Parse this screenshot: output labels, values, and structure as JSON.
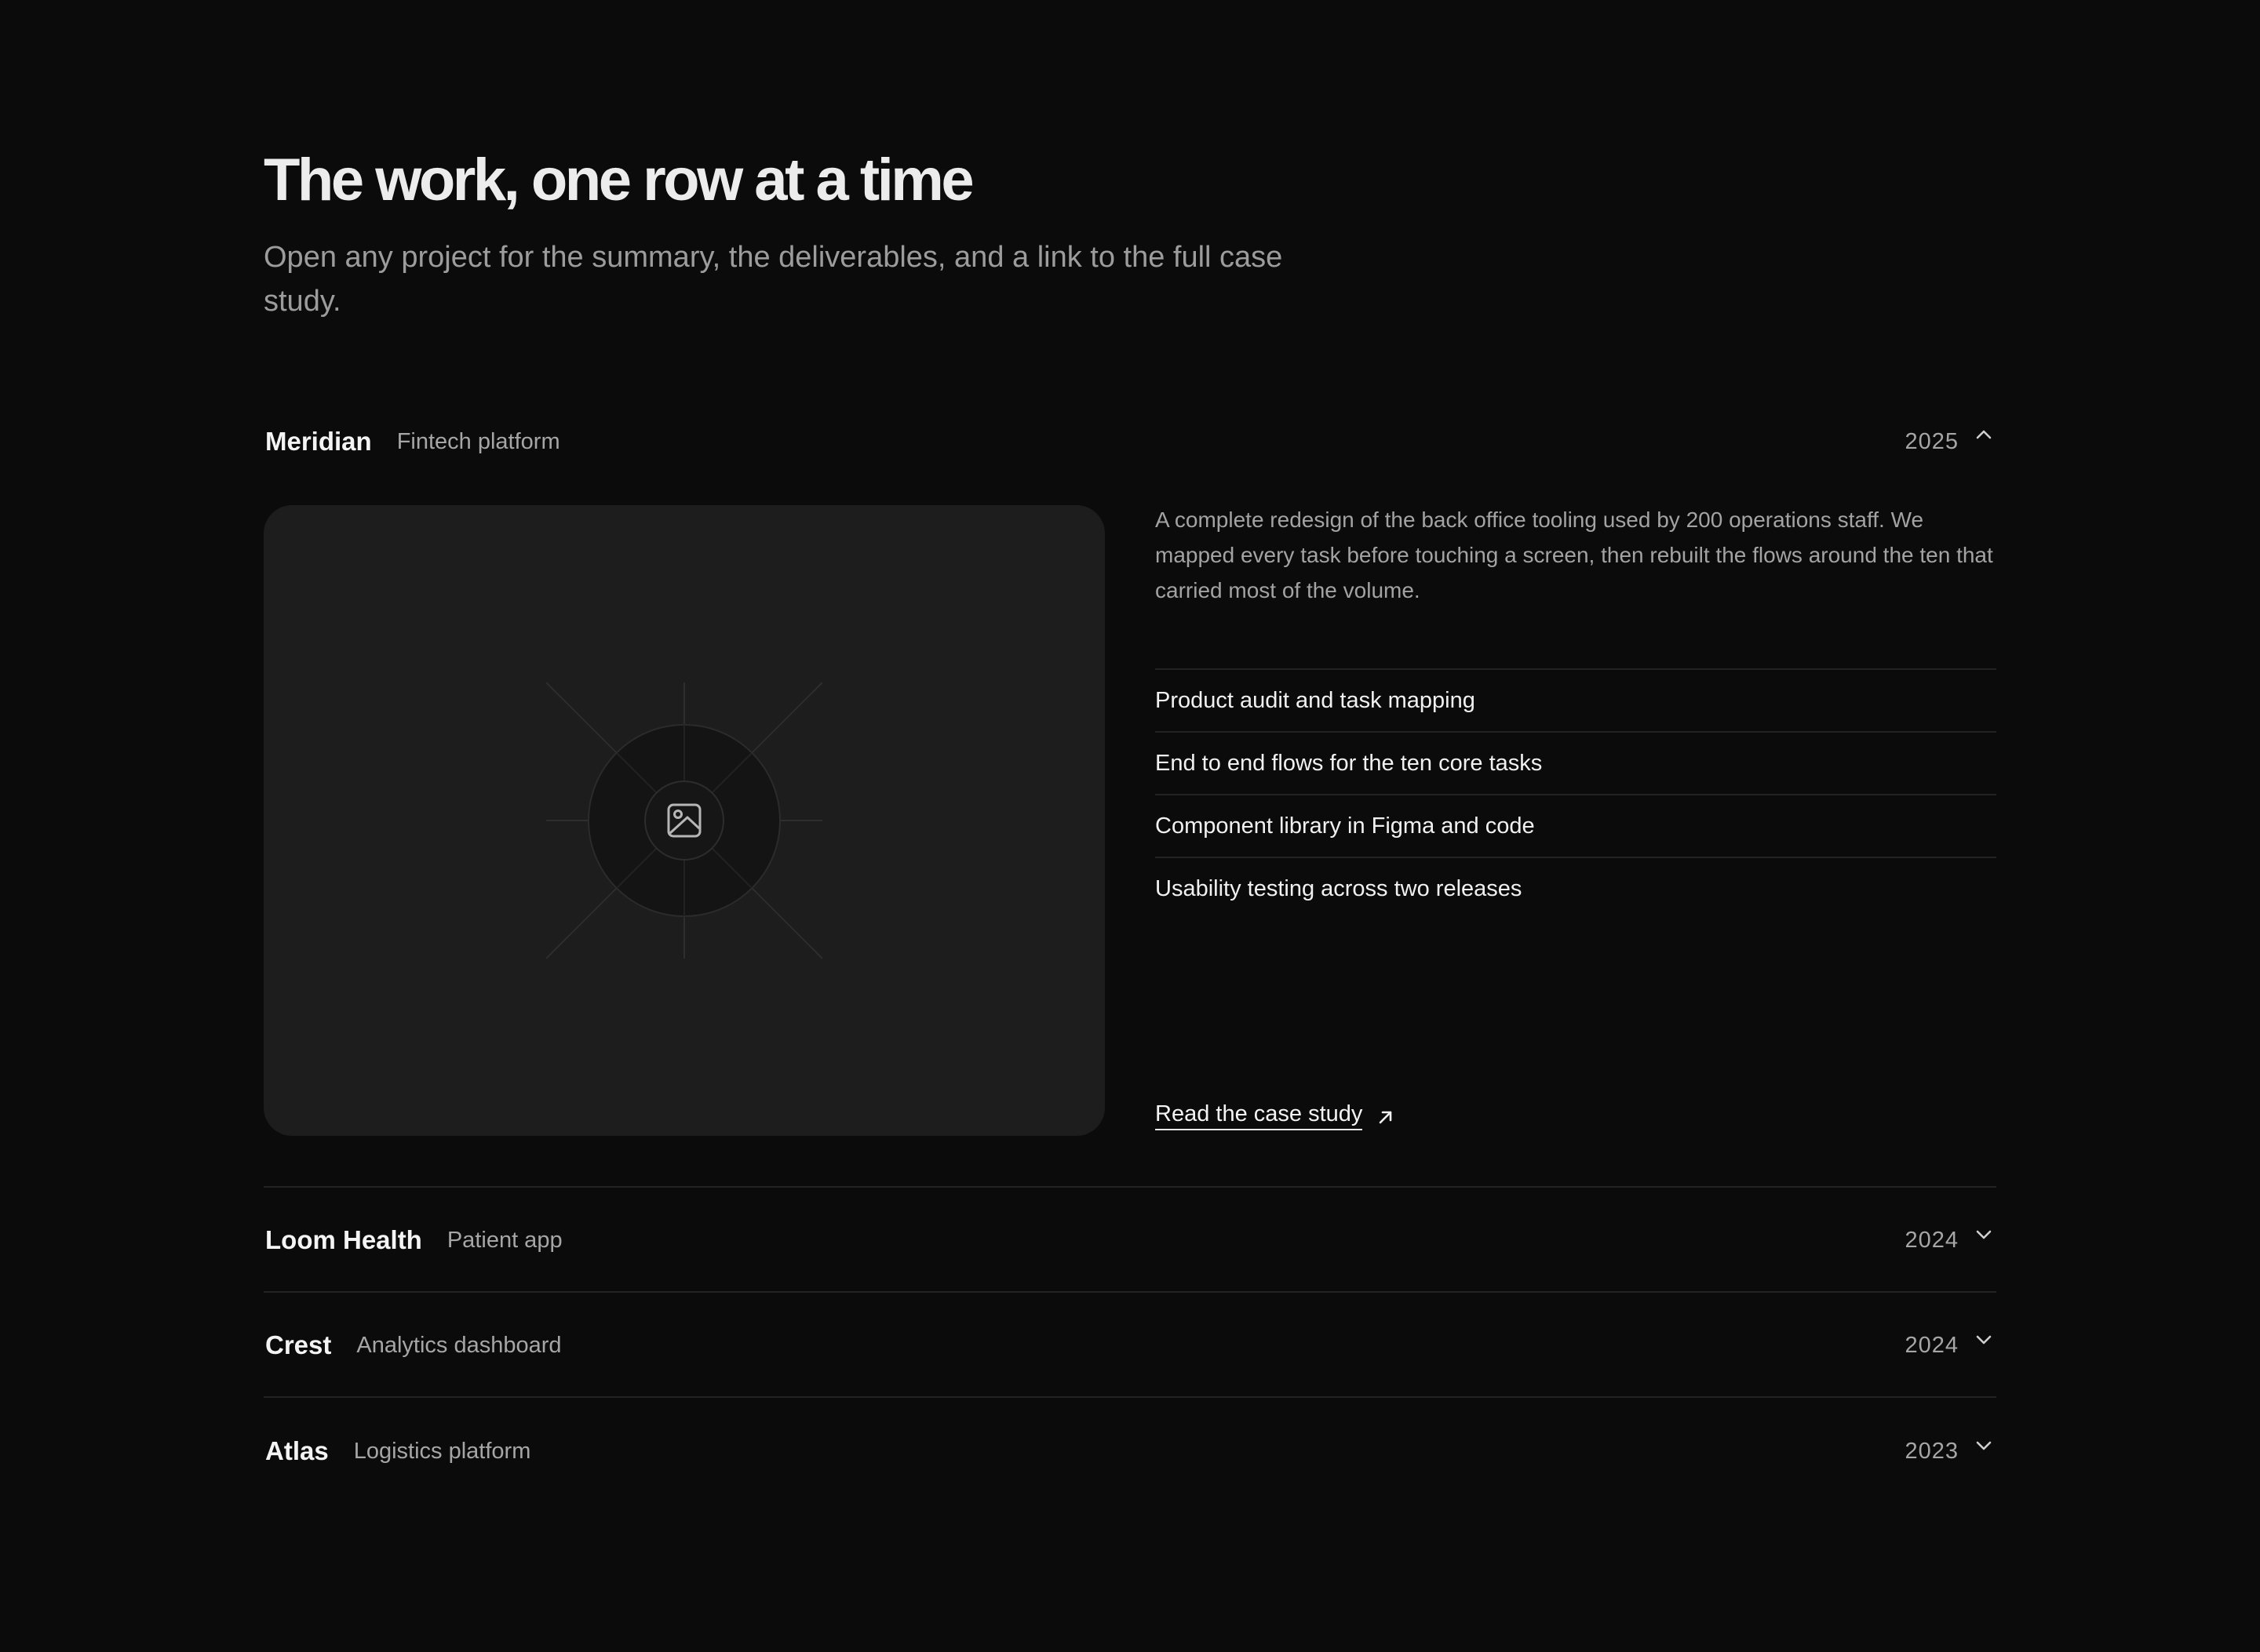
{
  "header": {
    "title": "The work, one row at a time",
    "subtitle": "Open any project for the summary, the deliverables, and a link to the full case study."
  },
  "projects": [
    {
      "name": "Meridian",
      "kind": "Fintech platform",
      "year": "2025",
      "state": "expanded",
      "chevron_icon": "chevron-up-icon",
      "media_icon": "image-icon",
      "description": "A complete redesign of the back office tooling used by 200 operations staff. We mapped every task before touching a screen, then rebuilt the flows around the ten that carried most of the volume.",
      "deliverables": [
        "Product audit and task mapping",
        "End to end flows for the ten core tasks",
        "Component library in Figma and code",
        "Usability testing across two releases"
      ],
      "link_label": "Read the case study",
      "link_icon": "arrow-up-right-icon"
    },
    {
      "name": "Loom Health",
      "kind": "Patient app",
      "year": "2024",
      "state": "collapsed",
      "chevron_icon": "chevron-down-icon"
    },
    {
      "name": "Crest",
      "kind": "Analytics dashboard",
      "year": "2024",
      "state": "collapsed",
      "chevron_icon": "chevron-down-icon"
    },
    {
      "name": "Atlas",
      "kind": "Logistics platform",
      "year": "2023",
      "state": "collapsed",
      "chevron_icon": "chevron-down-icon"
    }
  ],
  "colors": {
    "background": "#0b0b0b",
    "panel": "#1d1d1d",
    "text_primary": "#f2f2f2",
    "text_muted": "#a3a3a3",
    "divider": "#232323"
  }
}
